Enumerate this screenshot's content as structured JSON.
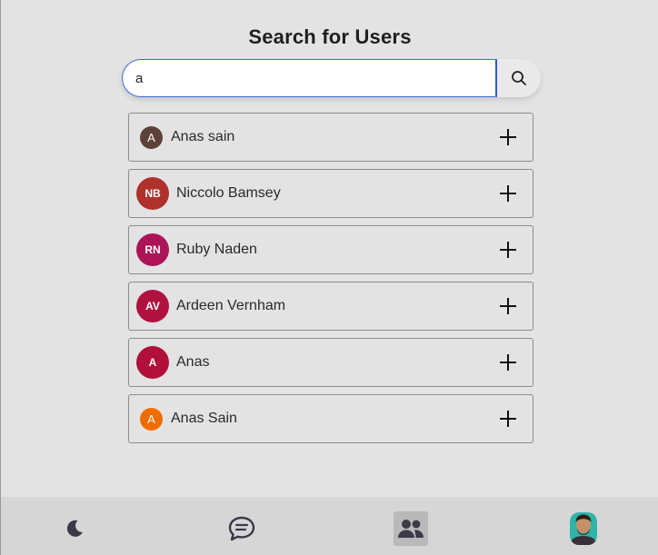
{
  "header": {
    "title": "Search for Users"
  },
  "search": {
    "value": "a",
    "button_icon": "search-icon"
  },
  "users": [
    {
      "name": "Anas sain",
      "initials": "A",
      "color": "#5d4037",
      "size": "small",
      "action_icon": "plus-icon"
    },
    {
      "name": "Niccolo Bamsey",
      "initials": "NB",
      "color": "#b0302b",
      "size": "big",
      "action_icon": "plus-icon"
    },
    {
      "name": "Ruby Naden",
      "initials": "RN",
      "color": "#ad1457",
      "size": "big",
      "action_icon": "plus-icon"
    },
    {
      "name": "Ardeen Vernham",
      "initials": "AV",
      "color": "#b0123f",
      "size": "big",
      "action_icon": "plus-icon"
    },
    {
      "name": "Anas",
      "initials": "A",
      "color": "#b0103a",
      "size": "big",
      "action_icon": "plus-icon"
    },
    {
      "name": "Anas Sain",
      "initials": "A",
      "color": "#ef6c00",
      "size": "small",
      "action_icon": "plus-icon"
    }
  ],
  "bottom_nav": {
    "items": [
      {
        "icon": "moon-icon",
        "active": false
      },
      {
        "icon": "chat-icon",
        "active": false
      },
      {
        "icon": "users-icon",
        "active": true
      },
      {
        "icon": "profile-avatar",
        "active": false
      }
    ]
  }
}
